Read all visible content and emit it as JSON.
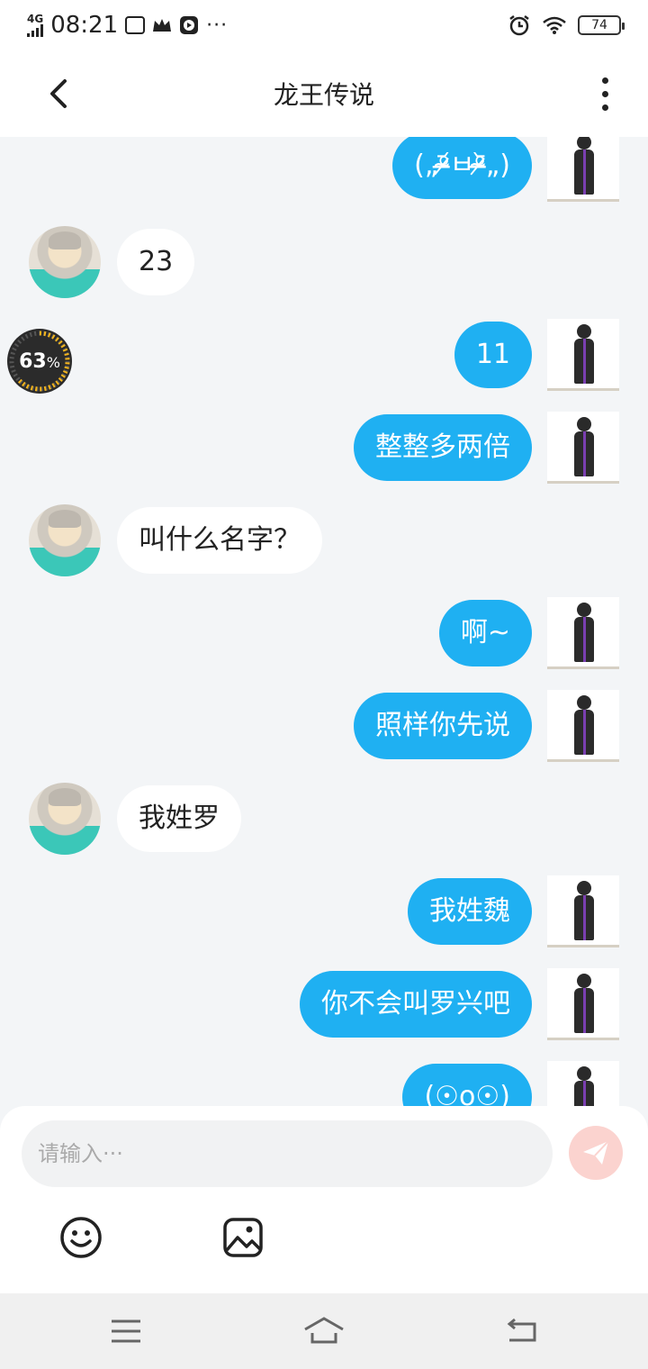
{
  "status_bar": {
    "network": "4G",
    "time": "08:21",
    "battery": "74"
  },
  "header": {
    "title": "龙王传说"
  },
  "messages": [
    {
      "side": "out",
      "text": "(„ᵒ̴̶̷᷄ㅂᵒ̴̶̷᷅„)"
    },
    {
      "side": "in",
      "text": "23"
    },
    {
      "side": "out",
      "text": "11"
    },
    {
      "side": "out",
      "text": "整整多两倍"
    },
    {
      "side": "in",
      "text": "叫什么名字？"
    },
    {
      "side": "out",
      "text": "啊~"
    },
    {
      "side": "out",
      "text": "照样你先说"
    },
    {
      "side": "in",
      "text": "我姓罗"
    },
    {
      "side": "out",
      "text": "我姓魏"
    },
    {
      "side": "out",
      "text": "你不会叫罗兴吧"
    },
    {
      "side": "out",
      "text": "(☉o☉)"
    }
  ],
  "progress_badge": {
    "value": "63",
    "unit": "%"
  },
  "input": {
    "placeholder": "请输入···"
  },
  "icons": {
    "back": "back-arrow-icon",
    "more": "more-vertical-icon",
    "send": "send-icon",
    "emoji": "emoji-icon",
    "image": "image-icon",
    "menu": "menu-icon",
    "home": "home-icon",
    "return": "return-icon"
  },
  "colors": {
    "outgoing_bubble": "#1fb0f2",
    "incoming_bubble": "#ffffff",
    "chat_background": "#f3f5f7",
    "send_button": "#fbd3cf"
  }
}
